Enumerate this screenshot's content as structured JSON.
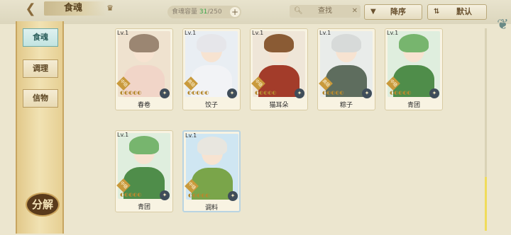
{
  "header": {
    "title": "食魂",
    "capacity_label": "食魂容量",
    "capacity_current": "31",
    "capacity_max": "/250",
    "search_label": "查找",
    "sort_label": "降序",
    "filter_label": "默认"
  },
  "sidebar": {
    "tabs": [
      "食魂",
      "调理",
      "信物"
    ],
    "decompose_label": "分解"
  },
  "cards": [
    {
      "name": "春卷",
      "level": "Lv.1",
      "rank": "中级",
      "colors": [
        "#efe2cf",
        "#9b8672",
        "#f1d5c8"
      ]
    },
    {
      "name": "饺子",
      "level": "Lv.1",
      "rank": "高级",
      "colors": [
        "#e9eef3",
        "#e6e6ea",
        "#f2f3f6"
      ]
    },
    {
      "name": "猫耳朵",
      "level": "Lv.1",
      "rank": "中级",
      "colors": [
        "#efe6d8",
        "#8a5b34",
        "#a33c2a"
      ]
    },
    {
      "name": "粽子",
      "level": "Lv.1",
      "rank": "高级",
      "colors": [
        "#e9ecea",
        "#d7dad9",
        "#5e6d5e"
      ]
    },
    {
      "name": "青团",
      "level": "Lv.1",
      "rank": "中级",
      "colors": [
        "#dfeede",
        "#77b56e",
        "#4f8d4a"
      ]
    },
    {
      "name": "青团",
      "level": "Lv.1",
      "rank": "中级",
      "colors": [
        "#dfeede",
        "#77b56e",
        "#4f8d4a"
      ]
    },
    {
      "name": "调料",
      "level": "Lv.1",
      "rank": "中级",
      "colors": [
        "#cfe6f2",
        "#e8e6df",
        "#7aa54a"
      ]
    }
  ]
}
